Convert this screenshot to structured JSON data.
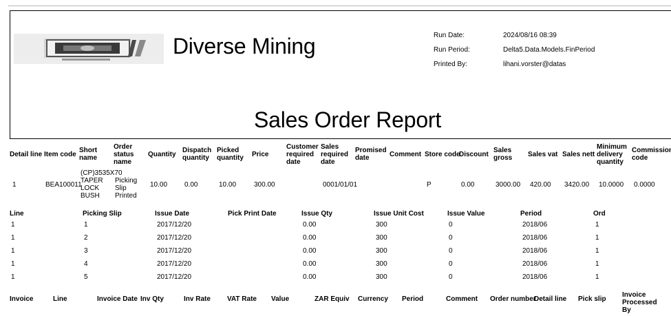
{
  "header": {
    "logo_alt": "No Image Available",
    "company_name": "Diverse Mining",
    "report_title": "Sales Order Report",
    "meta": [
      {
        "label": "Run Date:",
        "value": "2024/08/16 08:39"
      },
      {
        "label": "Run Period:",
        "value": "Delta5.Data.Models.FinPeriod"
      },
      {
        "label": "Printed By:",
        "value": "lihani.vorster@datas"
      }
    ]
  },
  "detail_table": {
    "headers": [
      "Detail line",
      "Item code",
      "Short name",
      "Order status name",
      "Quantity",
      "Dispatch quantity",
      "Picked quantity",
      "Price",
      "Customer required date",
      "Sales required date",
      "Promised date",
      "Comment",
      "Store code",
      "Discount",
      "Sales gross",
      "Sales vat",
      "Sales nett",
      "Minimum delivery quantity",
      "Commission code"
    ],
    "rows": [
      [
        "1",
        "BEA100011",
        "(CP)3535X70 TAPER LOCK BUSH",
        "Picking Slip Printed",
        "10.00",
        "0.00",
        "10.00",
        "300.00",
        "",
        "0001/01/01",
        "",
        "",
        "P",
        "0.00",
        "3000.00",
        "420.00",
        "3420.00",
        "10.0000",
        "0.0000"
      ]
    ]
  },
  "picking_table": {
    "headers": [
      "Line",
      "Picking Slip",
      "Issue Date",
      "Pick Print Date",
      "Issue Qty",
      "Issue Unit Cost",
      "Issue Value",
      "Period",
      "Ord"
    ],
    "rows": [
      [
        "1",
        "1",
        "2017/12/20",
        "",
        "0.00",
        "300",
        "0",
        "2018/06",
        "1"
      ],
      [
        "1",
        "2",
        "2017/12/20",
        "",
        "0.00",
        "300",
        "0",
        "2018/06",
        "1"
      ],
      [
        "1",
        "3",
        "2017/12/20",
        "",
        "0.00",
        "300",
        "0",
        "2018/06",
        "1"
      ],
      [
        "1",
        "4",
        "2017/12/20",
        "",
        "0.00",
        "300",
        "0",
        "2018/06",
        "1"
      ],
      [
        "1",
        "5",
        "2017/12/20",
        "",
        "0.00",
        "300",
        "0",
        "2018/06",
        "1"
      ]
    ]
  },
  "invoice_table": {
    "headers": [
      "Invoice",
      "Line",
      "Invoice Date",
      "Inv Qty",
      "Inv Rate",
      "VAT Rate",
      "Value",
      "ZAR Equiv",
      "Currency",
      "Period",
      "Comment",
      "Order number",
      "Detail line",
      "Pick slip",
      "Invoice Processed By"
    ]
  }
}
